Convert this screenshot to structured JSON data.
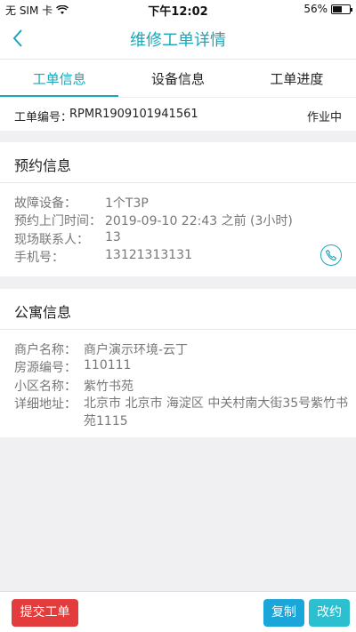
{
  "status_bar": {
    "carrier": "无 SIM 卡",
    "time": "下午12:02",
    "battery": "56%",
    "battery_level": 0.56
  },
  "nav": {
    "title": "维修工单详情"
  },
  "tabs": [
    {
      "label": "工单信息",
      "active": true
    },
    {
      "label": "设备信息",
      "active": false
    },
    {
      "label": "工单进度",
      "active": false
    }
  ],
  "order": {
    "label": "工单编号：",
    "number": "RPMR1909101941561",
    "status": "作业中"
  },
  "appointment": {
    "title": "预约信息",
    "fields": [
      {
        "label": "故障设备：",
        "value": "1个T3P"
      },
      {
        "label": "预约上门时间：",
        "value": "2019-09-10 22:43 之前 (3小时)"
      },
      {
        "label": "现场联系人：",
        "value": "13"
      },
      {
        "label": "手机号：",
        "value": "13121313131"
      }
    ]
  },
  "apartment": {
    "title": "公寓信息",
    "fields": [
      {
        "label": "商户名称：",
        "value": "商户演示环境-云丁"
      },
      {
        "label": "房源编号：",
        "value": "110111"
      },
      {
        "label": "小区名称：",
        "value": "紫竹书苑"
      },
      {
        "label": "详细地址：",
        "value": "北京市 北京市 海淀区 中关村南大街35号紫竹书苑1115"
      }
    ]
  },
  "actions": {
    "submit": "提交工单",
    "copy": "复制",
    "reschedule": "改约"
  },
  "colors": {
    "accent": "#1aa6b8",
    "danger": "#e23c3c",
    "copy": "#1aa6d8",
    "reschedule": "#2bbfcf"
  }
}
